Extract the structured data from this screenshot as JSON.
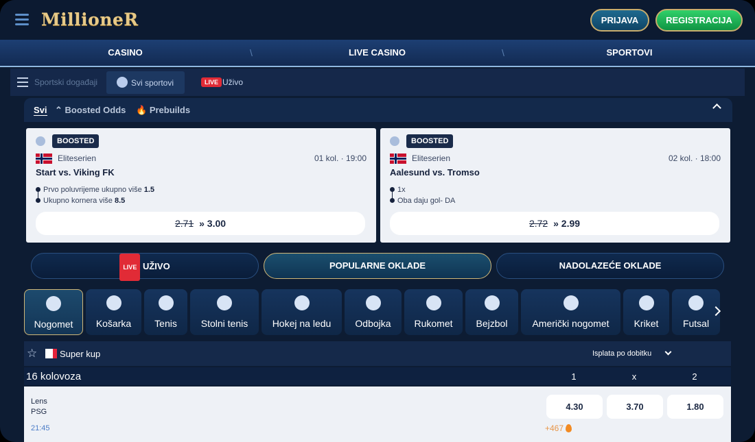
{
  "header": {
    "logo": "MillioneR",
    "login": "PRIJAVA",
    "register": "REGISTRACIJA"
  },
  "mainnav": [
    "CASINO",
    "LIVE CASINO",
    "SPORTOVI"
  ],
  "subnav": {
    "label": "Sportski događaji",
    "all_sports": "Svi sportovi",
    "live_badge": "LIVE",
    "live_label": "Uživo"
  },
  "boost_tabs": [
    "Svi",
    "Boosted Odds",
    "Prebuilds"
  ],
  "cards": [
    {
      "badge": "BOOSTED",
      "league": "Eliteserien",
      "time": "01 kol. · 19:00",
      "match": "Start vs. Viking FK",
      "sel1": "Prvo poluvrijeme ukupno više",
      "sel1_val": "1.5",
      "sel2": "Ukupno kornera više",
      "sel2_val": "8.5",
      "old_odds": "2.71",
      "arrow": "»",
      "new_odds": "3.00"
    },
    {
      "badge": "BOOSTED",
      "league": "Eliteserien",
      "time": "02 kol. · 18:00",
      "match": "Aalesund vs. Tromso",
      "sel1": "1x",
      "sel1_val": "",
      "sel2": "Oba daju gol- DA",
      "sel2_val": "",
      "old_odds": "2.72",
      "arrow": "»",
      "new_odds": "2.99"
    }
  ],
  "market_tabs": {
    "live_badge": "LIVE",
    "live": "UŽIVO",
    "popular": "POPULARNE OKLADE",
    "upcoming": "NADOLAZEĆE OKLADE"
  },
  "sports": [
    "Nogomet",
    "Košarka",
    "Tenis",
    "Stolni tenis",
    "Hokej na ledu",
    "Odbojka",
    "Rukomet",
    "Bejzbol",
    "Američki nogomet",
    "Kriket",
    "Futsal"
  ],
  "league": {
    "name": "Super kup",
    "payout_label": "Isplata po dobitku"
  },
  "date_row": {
    "date": "16 kolovoza",
    "h1": "1",
    "hx": "x",
    "h2": "2"
  },
  "event": {
    "home": "Lens",
    "away": "PSG",
    "time": "21:45",
    "odd1": "4.30",
    "oddx": "3.70",
    "odd2": "1.80",
    "more": "+467"
  },
  "colors": {
    "accent_gold": "#d1b878",
    "live_red": "#e12b36",
    "register_green": "#1fb555"
  }
}
